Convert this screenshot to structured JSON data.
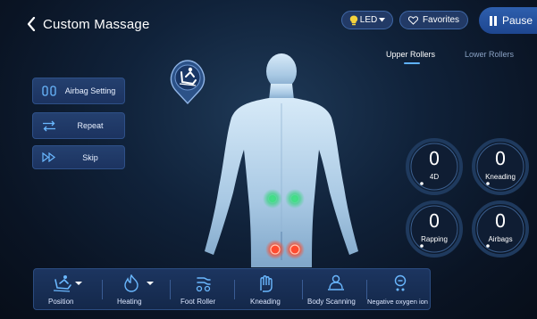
{
  "header": {
    "title": "Custom Massage",
    "led_label": "LED",
    "favorites_label": "Favorites",
    "pause_label": "Pause"
  },
  "roller_tabs": {
    "upper": "Upper Rollers",
    "lower": "Lower Rollers",
    "active": "upper"
  },
  "left_buttons": {
    "airbag_setting": "Airbag Setting",
    "repeat": "Repeat",
    "skip": "Skip"
  },
  "gauges": {
    "d4": {
      "value": "0",
      "label": "4D"
    },
    "kneading": {
      "value": "0",
      "label": "Kneading"
    },
    "rapping": {
      "value": "0",
      "label": "Rapping"
    },
    "airbags": {
      "value": "0",
      "label": "Airbags"
    }
  },
  "bottom_bar": {
    "position": "Position",
    "heating": "Heating",
    "foot_roller": "Foot Roller",
    "kneading": "Kneading",
    "body_scanning": "Body Scanning",
    "negative_oxygen_ion": "Negative oxygen ion"
  },
  "colors": {
    "accent": "#5fb2ff",
    "button_bg": "#223a66",
    "green_point": "#4fe08a",
    "red_point": "#ff5a3c"
  },
  "icons": [
    "back-chevron-icon",
    "lightbulb-icon",
    "heart-icon",
    "pause-icon",
    "airbag-icon",
    "repeat-icon",
    "skip-icon",
    "recline-icon",
    "position-icon",
    "heating-icon",
    "foot-roller-icon",
    "kneading-icon",
    "body-scanning-icon",
    "negative-oxygen-ion-icon"
  ]
}
